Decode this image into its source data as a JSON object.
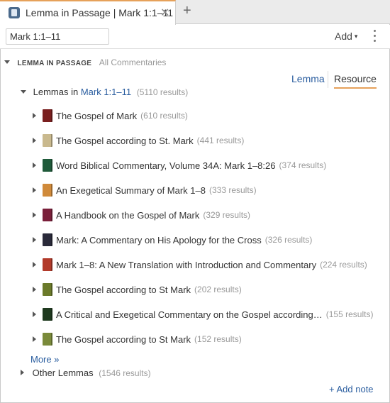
{
  "tab": {
    "title": "Lemma in Passage | Mark 1:1–11",
    "close": "✕",
    "add": "+"
  },
  "toolbar": {
    "reference_value": "Mark 1:1–11",
    "add_label": "Add",
    "add_caret": "▾"
  },
  "section": {
    "title": "LEMMA IN PASSAGE",
    "subtitle": "All Commentaries"
  },
  "toggle": {
    "lemma": "Lemma",
    "resource": "Resource"
  },
  "group": {
    "prefix": "Lemmas in",
    "reference": "Mark 1:1–11",
    "count": "(5110 results)"
  },
  "resources": [
    {
      "title": "The Gospel of Mark",
      "count": "(610 results)",
      "cover": "#7a1f1f"
    },
    {
      "title": "The Gospel according to St. Mark",
      "count": "(441 results)",
      "cover": "#c9b98e"
    },
    {
      "title": "Word Biblical Commentary, Volume 34A: Mark 1–8:26",
      "count": "(374 results)",
      "cover": "#1f5a3a"
    },
    {
      "title": "An Exegetical Summary of Mark 1–8",
      "count": "(333 results)",
      "cover": "#d08a3a"
    },
    {
      "title": "A Handbook on the Gospel of Mark",
      "count": "(329 results)",
      "cover": "#7a1f3a"
    },
    {
      "title": "Mark: A Commentary on His Apology for the Cross",
      "count": "(326 results)",
      "cover": "#2a2a3a"
    },
    {
      "title": "Mark 1–8: A New Translation with Introduction and Commentary",
      "count": "(224 results)",
      "cover": "#b23a2a"
    },
    {
      "title": "The Gospel according to St Mark",
      "count": "(202 results)",
      "cover": "#6b7a2a"
    },
    {
      "title": "A Critical and Exegetical Commentary on the Gospel according…",
      "count": "(155 results)",
      "cover": "#1f3a1f"
    },
    {
      "title": "The Gospel according to St Mark",
      "count": "(152 results)",
      "cover": "#7a8a3a"
    }
  ],
  "more": "More »",
  "other": {
    "label": "Other Lemmas",
    "count": "(1546 results)"
  },
  "add_note": "+ Add note"
}
